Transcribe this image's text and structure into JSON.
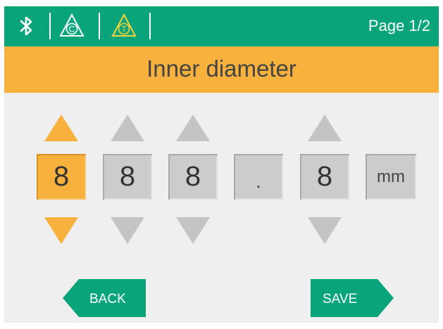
{
  "header": {
    "icons": [
      "bluetooth-icon",
      "triangle-c-icon",
      "triangle-t-icon"
    ],
    "icon_c_letter": "C",
    "icon_t_letter": "T",
    "page_label": "Page 1/2"
  },
  "title": "Inner diameter",
  "digits": [
    {
      "value": "8",
      "active": true
    },
    {
      "value": "8",
      "active": false
    },
    {
      "value": "8",
      "active": false
    },
    {
      "value": "8",
      "active": false
    }
  ],
  "decimal_separator": ".",
  "unit": "mm",
  "buttons": {
    "back_label": "BACK",
    "save_label": "SAVE"
  },
  "colors": {
    "header_bg": "#0aa47a",
    "accent": "#f7b13c",
    "inactive_control": "#cccccc",
    "screen_bg": "#efefef"
  }
}
